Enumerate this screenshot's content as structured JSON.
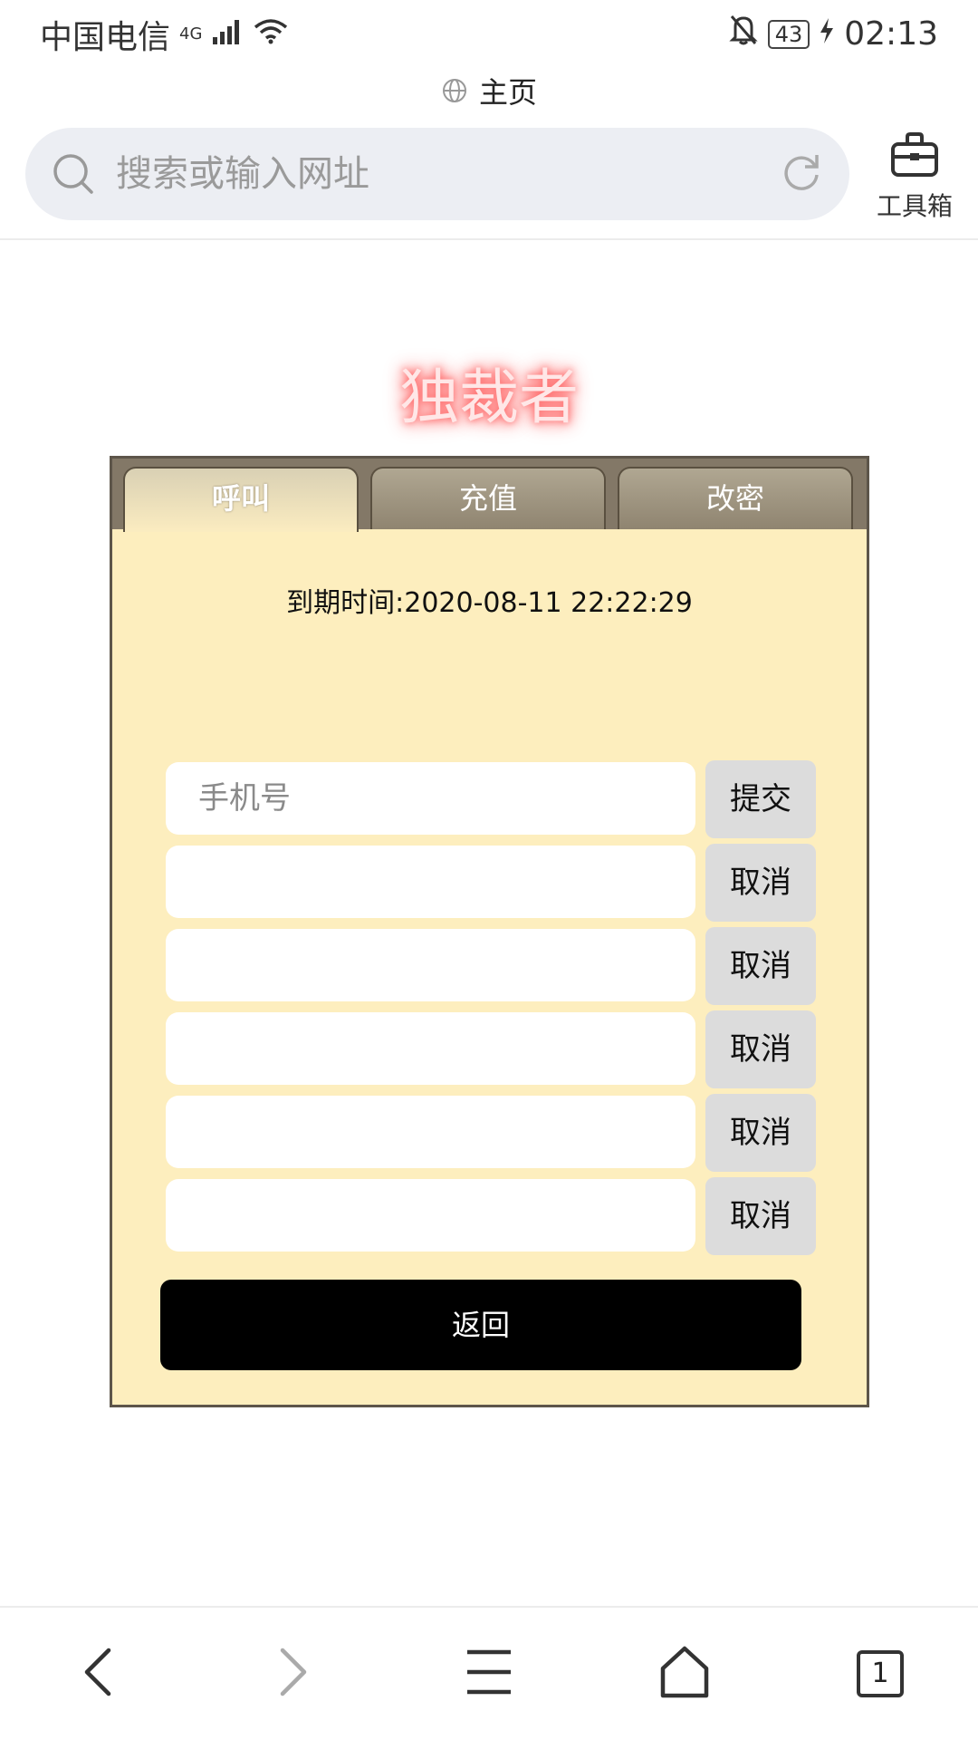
{
  "status_bar": {
    "carrier": "中国电信",
    "network": "4G",
    "battery": "43",
    "time": "02:13"
  },
  "browser": {
    "page_title": "主页",
    "search_placeholder": "搜索或输入网址",
    "toolbox_label": "工具箱",
    "tabs_count": "1"
  },
  "site": {
    "heading": "独裁者",
    "tabs": [
      "呼叫",
      "充值",
      "改密"
    ],
    "active_tab": 0,
    "expire_text": "到期时间:2020-08-11 22:22:29",
    "phone_placeholder": "手机号",
    "submit_label": "提交",
    "cancel_label": "取消",
    "back_label": "返回"
  },
  "colors": {
    "panel_bg": "#fdeebe",
    "tab_bar": "#837867",
    "heading_glow": "#ff6b6b",
    "back_button": "#000000"
  }
}
